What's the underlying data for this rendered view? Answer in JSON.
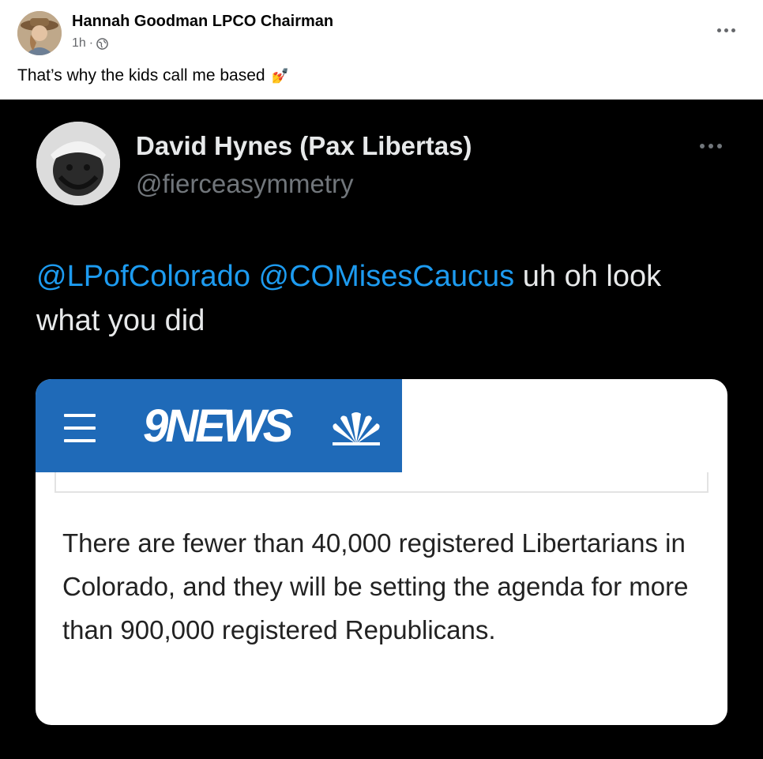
{
  "post": {
    "author": "Hannah Goodman LPCO Chairman",
    "time": "1h",
    "time_separator": "·",
    "caption": "That’s why the kids call me based",
    "caption_emoji": "💅",
    "privacy_icon": "globe-icon",
    "more_icon": "more-horizontal-icon"
  },
  "tweet": {
    "display_name": "David Hynes (Pax Libertas)",
    "handle": "@fierceasymmetry",
    "mentions": [
      "@LPofColorado",
      "@COMisesCaucus"
    ],
    "text_after_mentions": " uh oh look what you did",
    "more_icon": "more-horizontal-icon",
    "link_color": "#1d9bf0"
  },
  "news_card": {
    "logo": "9NEWS",
    "bar_color": "#1f6ab8",
    "menu_icon": "hamburger-icon",
    "network_icon": "nbc-peacock-icon",
    "body": "There are fewer than 40,000 registered Libertarians in Colorado, and they will be setting the agenda for more than 900,000 registered Republicans."
  }
}
